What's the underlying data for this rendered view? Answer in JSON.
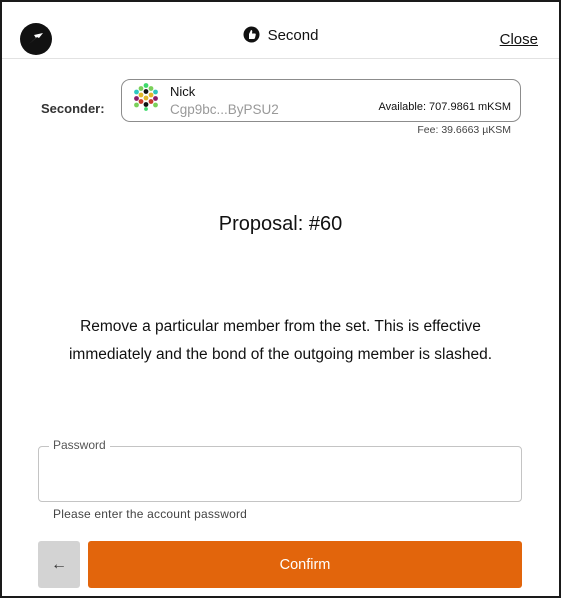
{
  "header": {
    "title": "Second",
    "close_label": "Close",
    "logo_icon": "bird-logo-icon",
    "title_icon": "second-icon"
  },
  "seconder": {
    "label": "Seconder:",
    "account_name": "Nick",
    "account_address": "Cgp9bc...ByPSU2",
    "available": "Available: 707.9861 mKSM",
    "fee": "Fee: 39.6663 µKSM"
  },
  "proposal": {
    "title": "Proposal: #60",
    "description": "Remove a particular member from the set. This is effective immediately and the bond of the outgoing member is slashed."
  },
  "password": {
    "label": "Password",
    "value": "",
    "hint": "Please enter the account password"
  },
  "actions": {
    "back_icon": "arrow-left-icon",
    "back_glyph": "←",
    "confirm_label": "Confirm"
  },
  "colors": {
    "confirm": "#e2650c",
    "back": "#d3d3d3"
  }
}
